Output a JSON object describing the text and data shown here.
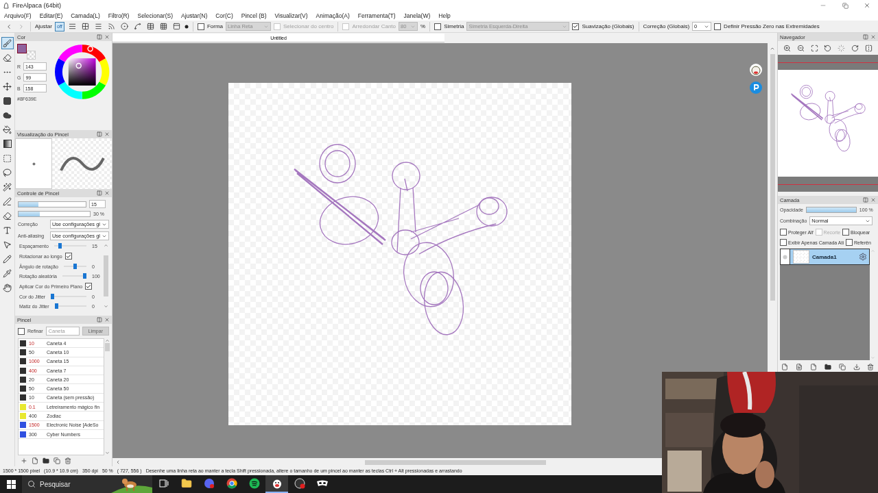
{
  "window": {
    "title": "FireAlpaca (64bit)"
  },
  "menu": [
    "Arquivo(F)",
    "Editar(E)",
    "Camada(L)",
    "Filtro(R)",
    "Selecionar(S)",
    "Ajustar(N)",
    "Cor(C)",
    "Pincel (B)",
    "Visualizar(V)",
    "Animação(A)",
    "Ferramenta(T)",
    "Janela(W)",
    "Help"
  ],
  "toolbar": {
    "adjust_label": "Ajustar",
    "snaps": [
      {
        "kind": "off",
        "label": "off",
        "selected": true
      },
      {
        "kind": "parallel",
        "selected": false
      },
      {
        "kind": "cross",
        "selected": false
      },
      {
        "kind": "lines",
        "selected": false
      },
      {
        "kind": "radial",
        "selected": false
      },
      {
        "kind": "circle",
        "selected": false
      },
      {
        "kind": "curve",
        "selected": false
      },
      {
        "kind": "perspective",
        "selected": false
      },
      {
        "kind": "grid",
        "selected": false
      },
      {
        "kind": "frame",
        "selected": false
      }
    ],
    "shape": {
      "label": "Forma",
      "checked": false,
      "value": "Linha Reta",
      "disabled": true
    },
    "from_center": {
      "label": "Selecionar do centro",
      "checked": false,
      "disabled": true
    },
    "round_corner": {
      "label": "Arredondar Canto",
      "checked": false,
      "disabled": true,
      "value": "80",
      "unit": "%"
    },
    "symmetry": {
      "label": "Simetria",
      "checked": false,
      "value": "Simetria Esquerda-Direita",
      "disabled": true
    },
    "smoothing": {
      "label": "Suavização (Globais)",
      "checked": true
    },
    "correction": {
      "label": "Correção (Globais)",
      "value": "0"
    },
    "zero_pressure": {
      "label": "Definir Pressão Zero nas Extremidades",
      "checked": false
    }
  },
  "tools": [
    {
      "kind": "brush",
      "selected": true
    },
    {
      "kind": "eraser",
      "selected": false
    },
    {
      "kind": "dot",
      "selected": false
    },
    {
      "kind": "move",
      "selected": false
    },
    {
      "kind": "fill",
      "selected": false
    },
    {
      "kind": "blob",
      "selected": false
    },
    {
      "kind": "bucket",
      "selected": false
    },
    {
      "kind": "gradient",
      "selected": false
    },
    {
      "kind": "rect-select",
      "selected": false
    },
    {
      "kind": "lasso",
      "selected": false
    },
    {
      "kind": "wand",
      "selected": false
    },
    {
      "kind": "select-pen",
      "selected": false
    },
    {
      "kind": "select-eraser",
      "selected": false
    },
    {
      "kind": "text",
      "selected": false
    },
    {
      "kind": "operation",
      "selected": false
    },
    {
      "kind": "divide",
      "selected": false
    },
    {
      "kind": "eyedropper",
      "selected": false
    },
    {
      "kind": "hand",
      "selected": false
    }
  ],
  "color_panel": {
    "title": "Cor",
    "color": "#8f639e",
    "channels": [
      {
        "label": "R",
        "value": "143"
      },
      {
        "label": "G",
        "value": "99"
      },
      {
        "label": "B",
        "value": "158"
      }
    ],
    "hex": "#8F639E"
  },
  "brush_preview": {
    "title": "Visualização do Pincel"
  },
  "brush_control": {
    "title": "Controle de Pincel",
    "size": {
      "level": 0.3,
      "value": "15"
    },
    "opacity": {
      "level": 0.3,
      "value": "30 %"
    },
    "correction": {
      "label": "Correção",
      "value": "Use configurações gl"
    },
    "antialias": {
      "label": "Anti-aliasing",
      "value": "Use configurações gl"
    },
    "params": [
      {
        "kind": "slider",
        "label": "Espaçamento",
        "level": 0.15,
        "value": "15"
      },
      {
        "kind": "checkbox",
        "label": "Rotacionar ao longo",
        "checked": true
      },
      {
        "kind": "slider",
        "label": "Ângulo de rotação",
        "level": 0.5,
        "value": "0"
      },
      {
        "kind": "slider",
        "label": "Rotação aleatória",
        "level": 1,
        "value": "100"
      },
      {
        "kind": "checkbox",
        "label": "Aplicar Cor do Primeiro Plano",
        "checked": true
      },
      {
        "kind": "slider",
        "label": "Cor do Jitter",
        "level": 0,
        "value": "0"
      },
      {
        "kind": "slider",
        "label": "Matiz do Jitter",
        "level": 0,
        "value": "0"
      }
    ]
  },
  "brush_panel": {
    "title": "Pincel",
    "refine": {
      "label": "Refinar",
      "checked": false
    },
    "filter_placeholder": "Caneta",
    "clear_button": {
      "label": "Limpar",
      "disabled": true
    },
    "brushes": [
      {
        "color": "#303030",
        "size": "10",
        "pressure": true,
        "name": "Caneta 4"
      },
      {
        "color": "#303030",
        "size": "50",
        "pressure": false,
        "name": "Caneta 10"
      },
      {
        "color": "#303030",
        "size": "1000",
        "pressure": true,
        "name": "Caneta 15"
      },
      {
        "color": "#303030",
        "size": "400",
        "pressure": true,
        "name": "Caneta 7"
      },
      {
        "color": "#303030",
        "size": "20",
        "pressure": false,
        "name": "Caneta 20"
      },
      {
        "color": "#303030",
        "size": "50",
        "pressure": false,
        "name": "Caneta 50"
      },
      {
        "color": "#303030",
        "size": "10",
        "pressure": false,
        "name": "Caneta (sem pressão)"
      },
      {
        "color": "#e8e830",
        "size": "0.1",
        "pressure": true,
        "name": "Letreiramento mágico fin"
      },
      {
        "color": "#e8e830",
        "size": "400",
        "pressure": false,
        "name": "Zodiac"
      },
      {
        "color": "#3050e0",
        "size": "1500",
        "pressure": true,
        "name": "Electronic Noise [AdeSo"
      },
      {
        "color": "#3050e0",
        "size": "300",
        "pressure": false,
        "name": "Cyber Numbers"
      }
    ]
  },
  "canvas": {
    "tab": "Untitled"
  },
  "navigator": {
    "title": "Navegador"
  },
  "layer_panel": {
    "title": "Camada",
    "opacity": {
      "label": "Opacidade",
      "level": 1,
      "value": "100 %"
    },
    "blend": {
      "label": "Combinação",
      "value": "Normal"
    },
    "options": [
      {
        "label": "Proteger Alf",
        "checked": false,
        "disabled": false
      },
      {
        "label": "Recorte",
        "checked": false,
        "disabled": true
      },
      {
        "label": "Bloquear",
        "checked": false,
        "disabled": false
      },
      {
        "label": "Exibir Apenas Camada Ati",
        "checked": false,
        "disabled": false
      },
      {
        "label": "Referên",
        "checked": false,
        "disabled": false
      }
    ],
    "layers": [
      {
        "name": "Camada1",
        "selected": true
      }
    ]
  },
  "status_bar": [
    "1500 * 1500 pixel",
    "(10.9 * 10.9 cm)",
    "350 dpi",
    "50 %",
    "( 727, 556 )",
    "Desenhe uma linha reta ao manter a tecla Shift pressionada, altere o tamanho de um pincel ao manter as teclas Ctrl + Alt pressionadas e arrastando"
  ],
  "taskbar": {
    "search_placeholder": "Pesquisar",
    "apps": [
      {
        "kind": "task-view",
        "selected": false
      },
      {
        "kind": "folder",
        "selected": false
      },
      {
        "kind": "discord",
        "selected": false
      },
      {
        "kind": "chrome",
        "selected": false
      },
      {
        "kind": "spotify",
        "selected": false
      },
      {
        "kind": "alpaca",
        "selected": true
      },
      {
        "kind": "obs",
        "selected": false
      },
      {
        "kind": "mask",
        "selected": false
      }
    ]
  },
  "webcam": {
    "kind": "picture"
  }
}
